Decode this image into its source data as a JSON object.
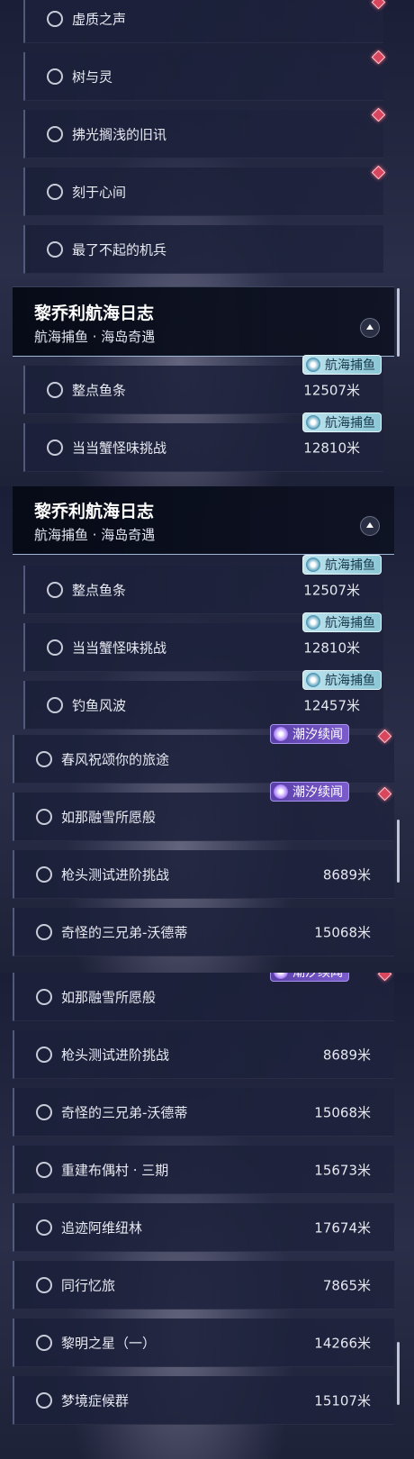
{
  "panel1": {
    "rows": [
      {
        "name": "虚质之声"
      },
      {
        "name": "树与灵"
      },
      {
        "name": "拂光搁浅的旧讯"
      },
      {
        "name": "刻于心间"
      },
      {
        "name": "最了不起的机兵"
      }
    ],
    "header": {
      "title": "黎乔利航海日志",
      "subtitle": "航海捕鱼 · 海岛奇遇"
    },
    "quests": [
      {
        "name": "整点鱼条",
        "dist": "12507米",
        "tag": "航海捕鱼"
      },
      {
        "name": "当当蟹怪味挑战",
        "dist": "12810米",
        "tag": "航海捕鱼"
      }
    ]
  },
  "panel2": {
    "header": {
      "title": "黎乔利航海日志",
      "subtitle": "航海捕鱼 · 海岛奇遇"
    },
    "quests": [
      {
        "name": "整点鱼条",
        "dist": "12507米",
        "tag": "航海捕鱼"
      },
      {
        "name": "当当蟹怪味挑战",
        "dist": "12810米",
        "tag": "航海捕鱼"
      },
      {
        "name": "钓鱼风波",
        "dist": "12457米",
        "tag": "航海捕鱼"
      }
    ],
    "rows": [
      {
        "name": "春风祝颂你的旅途",
        "tag": "潮汐续闻"
      },
      {
        "name": "如那融雪所愿般",
        "tag": "潮汐续闻"
      },
      {
        "name": "枪头测试进阶挑战",
        "dist": "8689米"
      },
      {
        "name": "奇怪的三兄弟-沃德蒂",
        "dist": "15068米"
      }
    ]
  },
  "panel3": {
    "rows": [
      {
        "name": "如那融雪所愿般",
        "tag": "潮汐续闻"
      },
      {
        "name": "枪头测试进阶挑战",
        "dist": "8689米"
      },
      {
        "name": "奇怪的三兄弟-沃德蒂",
        "dist": "15068米"
      },
      {
        "name": "重建布偶村 · 三期",
        "dist": "15673米"
      },
      {
        "name": "追迹阿维纽林",
        "dist": "17674米"
      },
      {
        "name": "同行忆旅",
        "dist": "7865米"
      },
      {
        "name": "黎明之星（一）",
        "dist": "14266米"
      },
      {
        "name": "梦境症候群",
        "dist": "15107米"
      }
    ]
  },
  "colors": {
    "tag_fish": "#8cc7d6",
    "tag_tide": "#6a4cc0",
    "diamond": "#d9475e",
    "header_line": "#9fb6d6"
  },
  "icons": {
    "status": "circle-outline-icon",
    "fish_tag": "fishing-emblem-icon",
    "tide_tag": "tide-emblem-icon",
    "marker": "red-diamond-icon",
    "collapse": "chevron-up-icon"
  }
}
